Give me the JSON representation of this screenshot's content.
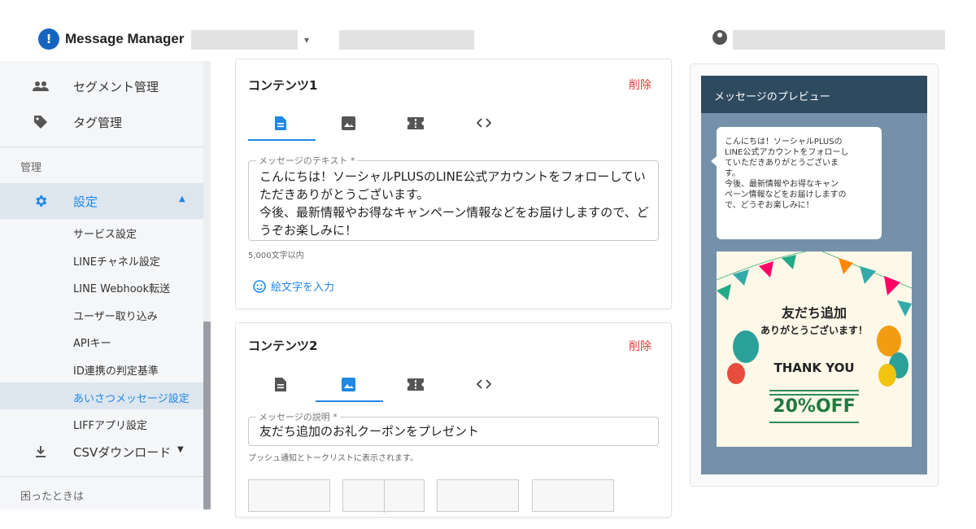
{
  "header": {
    "logo_letter": "!",
    "brand": "Message Manager"
  },
  "sidebar": {
    "top_items": [
      {
        "label": "セグメント管理",
        "icon": "people-icon"
      },
      {
        "label": "タグ管理",
        "icon": "tag-icon"
      }
    ],
    "section_manage": "管理",
    "settings": {
      "label": "設定",
      "icon": "gear-icon",
      "expanded": true
    },
    "sub_items": [
      "サービス設定",
      "LINEチャネル設定",
      "LINE Webhook転送",
      "ユーザー取り込み",
      "APIキー",
      "ID連携の判定基準",
      "あいさつメッセージ設定",
      "LIFFアプリ設定"
    ],
    "active_sub_index": 6,
    "csv": {
      "label": "CSVダウンロード",
      "icon": "download-icon"
    },
    "help": "困ったときは"
  },
  "content1": {
    "title": "コンテンツ1",
    "delete_label": "削除",
    "legend": "メッセージのテキスト *",
    "text_lines": [
      "こんにちは！ソーシャルPLUSのLINE公式アカウントをフォローしてい",
      "ただきありがとうございます。",
      "今後、最新情報やお得なキャンペーン情報などをお届けしますので、ど",
      "うぞお楽しみに！"
    ],
    "hint": "5,000文字以内",
    "emoji_link": "絵文字を入力",
    "active_tab": 0
  },
  "content2": {
    "title": "コンテンツ2",
    "delete_label": "削除",
    "legend": "メッセージの説明 *",
    "value": "友だち追加のお礼クーポンをプレゼント",
    "hint": "プッシュ通知とトークリストに表示されます。",
    "active_tab": 1
  },
  "tabs_icons": [
    "document-icon",
    "image-icon",
    "coupon-icon",
    "code-icon"
  ],
  "preview": {
    "title": "メッセージのプレビュー",
    "bubble_lines": [
      "こんにちは！ソーシャルPLUSの",
      "LINE公式アカウントをフォローし",
      "ていただきありがとうございま",
      "す。",
      "今後、最新情報やお得なキャン",
      "ペーン情報などをお届けしますの",
      "で、どうぞお楽しみに！"
    ],
    "coupon": {
      "line1": "友だち追加",
      "line2": "ありがとうございます！",
      "line3": "THANK YOU",
      "line4": "20%OFF"
    }
  },
  "colors": {
    "accent": "#1e88e5",
    "danger": "#e53935",
    "preview_head": "#2e4a5f",
    "preview_body": "#7491a9",
    "active_bg": "#dde5ef"
  }
}
